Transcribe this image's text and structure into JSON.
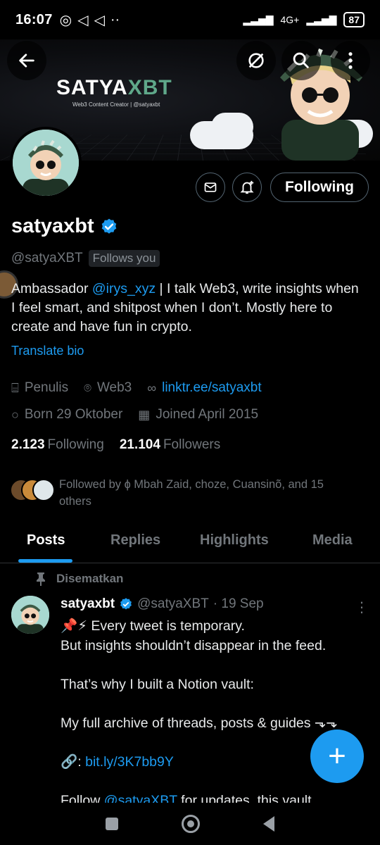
{
  "status_bar": {
    "time": "16:07",
    "battery": "87",
    "network": "4G+"
  },
  "banner": {
    "brand_main": "SATYA",
    "brand_accent": "XBT",
    "brand_sub": "Web3 Content Creator | @satyaxbt"
  },
  "header": {
    "back_icon": "arrow-left-icon",
    "grok_icon": "slash-circle-icon",
    "search_icon": "search-icon",
    "more_icon": "more-vertical-icon"
  },
  "actions": {
    "message_icon": "mail-icon",
    "notify_icon": "bell-plus-icon",
    "following_label": "Following"
  },
  "profile": {
    "display_name": "satyaxbt",
    "handle": "@satyaXBT",
    "follows_you": "Follows you",
    "bio_prefix": "Ambassador ",
    "bio_mention": "@irys_xyz",
    "bio_suffix": "  | I talk Web3, write insights when I feel smart, and shitpost when I don’t. Mostly here to create and have fun in crypto.",
    "translate": "Translate bio",
    "category": "Penulis",
    "location": "Web3",
    "website": "linktr.ee/satyaxbt",
    "born": "Born 29 Oktober",
    "joined": "Joined April 2015",
    "following_count": "2.123",
    "following_label": "Following",
    "followers_count": "21.104",
    "followers_label": "Followers",
    "followed_by": "Followed by ɸ Mbah Zaid, choze, Cuansinõ, and 15 others"
  },
  "tabs": [
    "Posts",
    "Replies",
    "Highlights",
    "Media"
  ],
  "pinned_post": {
    "pinned_label": "Disematkan",
    "name": "satyaxbt",
    "handle": "@satyaXBT",
    "date": "· 19 Sep",
    "line1": "📌⚡ Every tweet is temporary.",
    "line2": "But insights shouldn’t disappear in the feed.",
    "line3": "That’s why I built a Notion vault:",
    "line4": "My full archive of threads, posts & guides ⬎⬎",
    "link_prefix": "🔗: ",
    "link": "bit.ly/3K7bb9Y",
    "line5_prefix": "Follow ",
    "line5_mention": "@satyaXBT",
    "line5_suffix": " for updates, this vault"
  },
  "fab_label": "+"
}
